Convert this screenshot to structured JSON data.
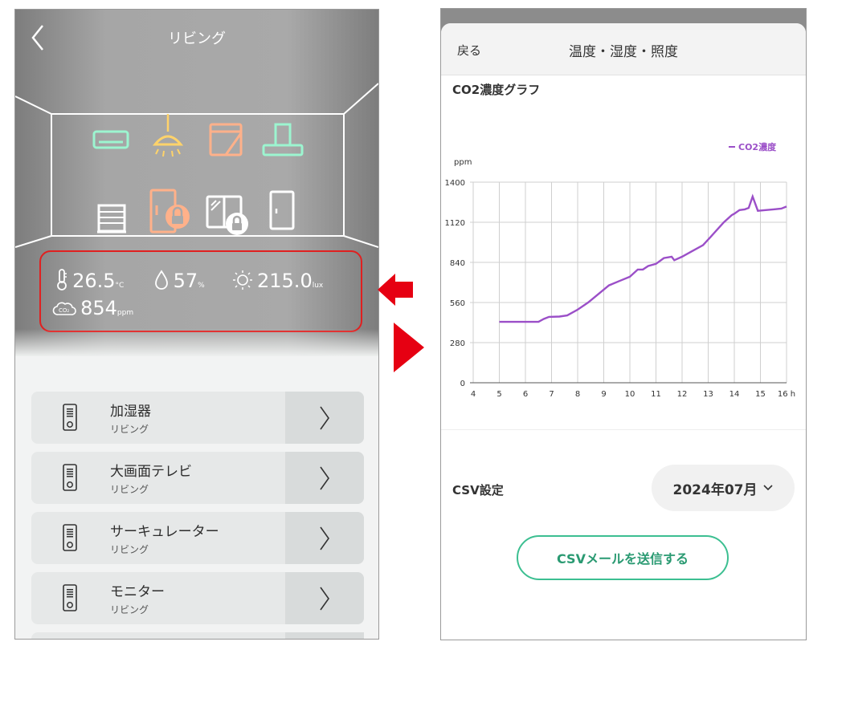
{
  "left_screen": {
    "title": "リビング",
    "sensors": {
      "temperature": {
        "value": "26.5",
        "unit": "°C",
        "icon": "thermometer-icon"
      },
      "humidity": {
        "value": "57",
        "unit": "%",
        "icon": "droplet-icon"
      },
      "illuminance": {
        "value": "215.0",
        "unit": "lux",
        "icon": "sun-icon"
      },
      "co2": {
        "value": "854",
        "unit": "ppm",
        "icon": "co2-cloud-icon"
      }
    },
    "devices": [
      {
        "name": "加湿器",
        "room": "リビング"
      },
      {
        "name": "大画面テレビ",
        "room": "リビング"
      },
      {
        "name": "サーキュレーター",
        "room": "リビング"
      },
      {
        "name": "モニター",
        "room": "リビング"
      }
    ],
    "highlight_color": "#e02020"
  },
  "right_screen": {
    "back_label": "戻る",
    "title": "温度・湿度・照度",
    "chart_title": "CO2濃度グラフ",
    "csv_label": "CSV設定",
    "month": "2024年07月",
    "csv_button": "CSVメールを送信する",
    "accent_color": "#3cbf91"
  },
  "chart_data": {
    "type": "line",
    "title": "CO2濃度グラフ",
    "ylabel": "ppm",
    "xlabel": "",
    "x_unit": "h",
    "xlim": [
      4,
      16
    ],
    "ylim": [
      0,
      1400
    ],
    "x_ticks": [
      4,
      5,
      6,
      7,
      8,
      9,
      10,
      11,
      12,
      13,
      14,
      15,
      16
    ],
    "y_ticks": [
      0,
      280,
      560,
      840,
      1120,
      1400
    ],
    "grid": true,
    "legend": "top-right",
    "series": [
      {
        "name": "CO2濃度",
        "color": "#9b4fc8",
        "x": [
          5,
          5.5,
          6,
          6.5,
          6.7,
          6.9,
          7.3,
          7.6,
          8,
          8.4,
          8.8,
          9.2,
          9.6,
          10,
          10.3,
          10.5,
          10.7,
          11,
          11.3,
          11.6,
          11.7,
          12,
          12.4,
          12.8,
          13.1,
          13.3,
          13.6,
          13.9,
          14,
          14.2,
          14.4,
          14.55,
          14.7,
          14.9,
          15.2,
          15.5,
          15.8,
          16
        ],
        "y": [
          425,
          425,
          425,
          425,
          445,
          460,
          462,
          470,
          510,
          560,
          620,
          680,
          710,
          740,
          790,
          790,
          815,
          830,
          870,
          880,
          855,
          880,
          920,
          960,
          1020,
          1060,
          1120,
          1170,
          1180,
          1205,
          1210,
          1220,
          1300,
          1200,
          1205,
          1210,
          1215,
          1230
        ]
      }
    ]
  }
}
